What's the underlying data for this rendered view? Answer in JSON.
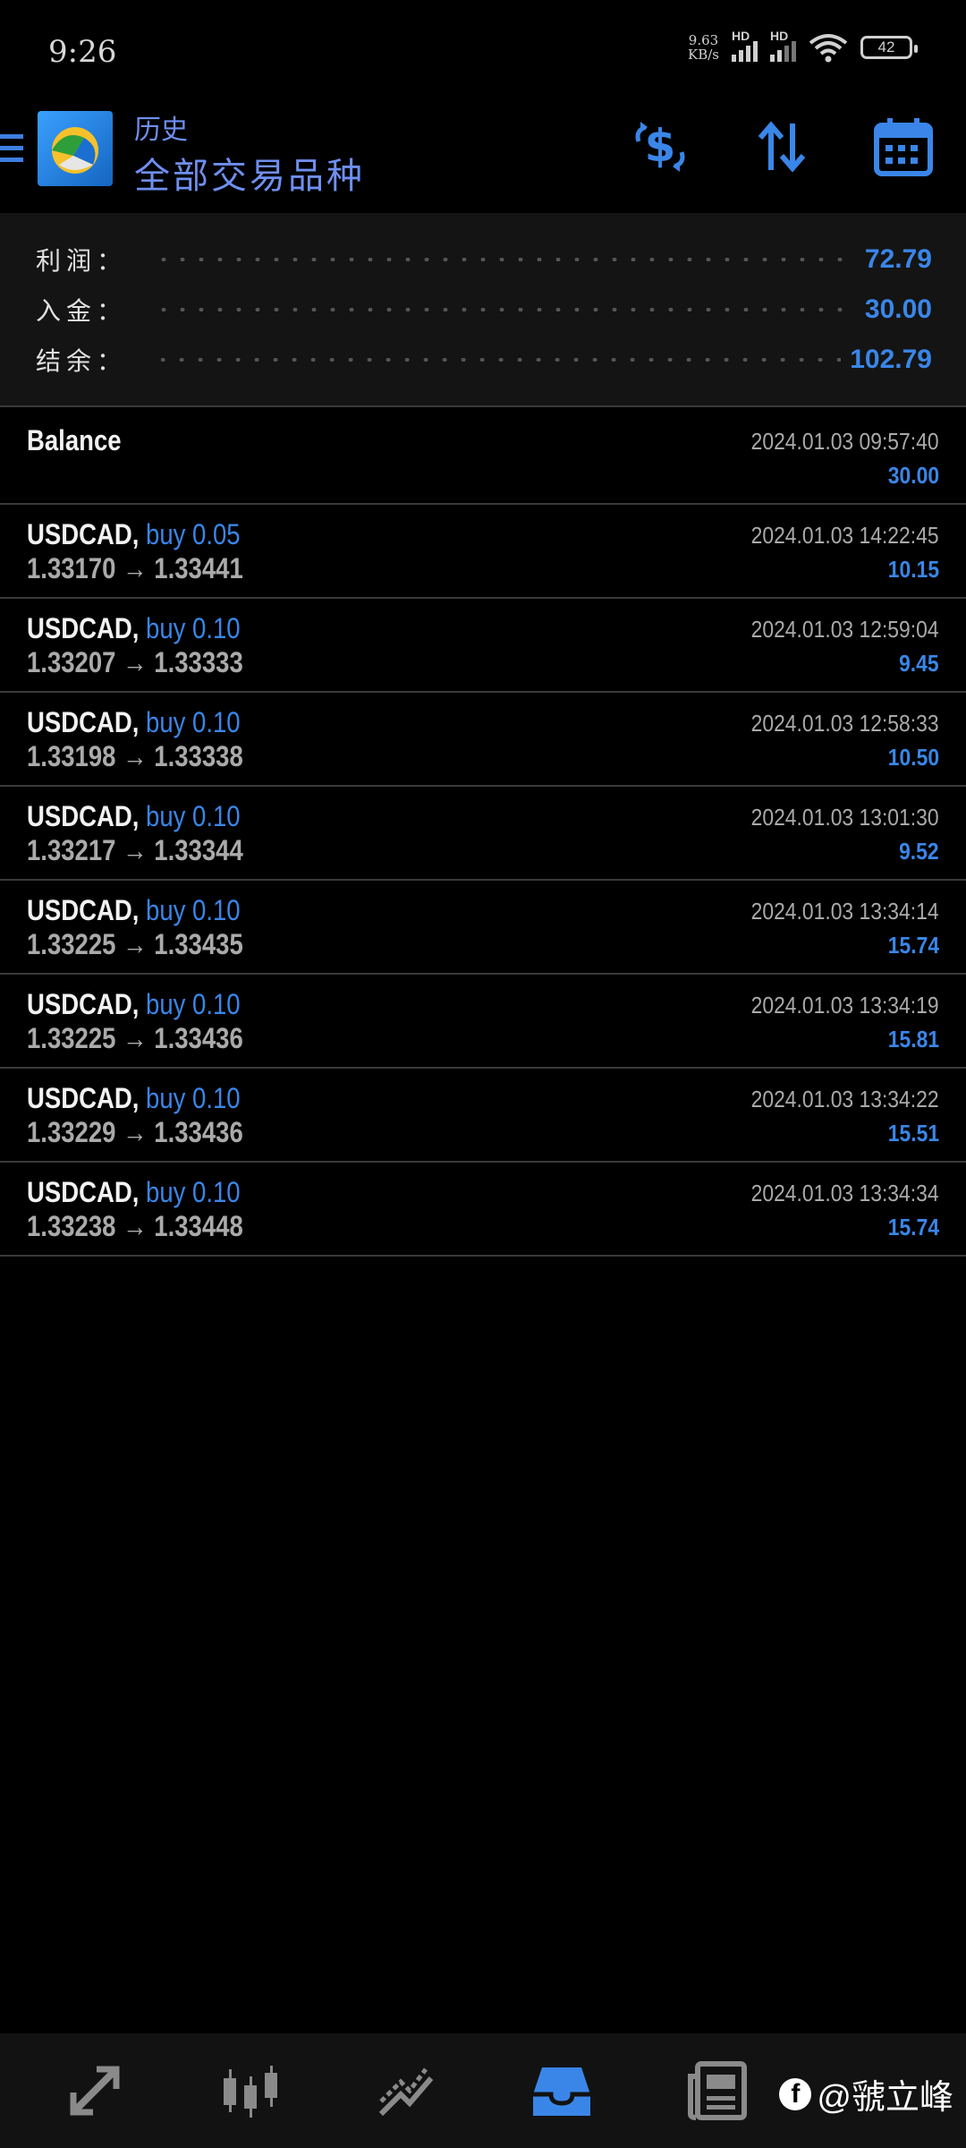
{
  "status_bar": {
    "time": "9:26",
    "net_speed_value": "9.63",
    "net_speed_unit": "KB/s",
    "hd1": "HD",
    "hd2": "HD",
    "battery": "42"
  },
  "header": {
    "subtitle": "历史",
    "title": "全部交易品种",
    "accent_color": "#3a86e8"
  },
  "summary": {
    "profit_label": "利润：",
    "profit_value": "72.79",
    "deposit_label": "入金：",
    "deposit_value": "30.00",
    "balance_label": "结余：",
    "balance_value": "102.79"
  },
  "balance_entry": {
    "label": "Balance",
    "datetime": "2024.01.03 09:57:40",
    "amount": "30.00"
  },
  "deals": [
    {
      "symbol": "USDCAD,",
      "type": "buy 0.05",
      "prices": "1.33170 → 1.33441",
      "datetime": "2024.01.03 14:22:45",
      "profit": "10.15"
    },
    {
      "symbol": "USDCAD,",
      "type": "buy 0.10",
      "prices": "1.33207 → 1.33333",
      "datetime": "2024.01.03 12:59:04",
      "profit": "9.45"
    },
    {
      "symbol": "USDCAD,",
      "type": "buy 0.10",
      "prices": "1.33198 → 1.33338",
      "datetime": "2024.01.03 12:58:33",
      "profit": "10.50"
    },
    {
      "symbol": "USDCAD,",
      "type": "buy 0.10",
      "prices": "1.33217 → 1.33344",
      "datetime": "2024.01.03 13:01:30",
      "profit": "9.52"
    },
    {
      "symbol": "USDCAD,",
      "type": "buy 0.10",
      "prices": "1.33225 → 1.33435",
      "datetime": "2024.01.03 13:34:14",
      "profit": "15.74"
    },
    {
      "symbol": "USDCAD,",
      "type": "buy 0.10",
      "prices": "1.33225 → 1.33436",
      "datetime": "2024.01.03 13:34:19",
      "profit": "15.81"
    },
    {
      "symbol": "USDCAD,",
      "type": "buy 0.10",
      "prices": "1.33229 → 1.33436",
      "datetime": "2024.01.03 13:34:22",
      "profit": "15.51"
    },
    {
      "symbol": "USDCAD,",
      "type": "buy 0.10",
      "prices": "1.33238 → 1.33448",
      "datetime": "2024.01.03 13:34:34",
      "profit": "15.74"
    }
  ],
  "bottom_nav": {
    "items": [
      "quotes-icon",
      "chart-icon",
      "trade-icon",
      "history-icon",
      "news-icon"
    ],
    "active": "history-icon"
  },
  "watermark": {
    "text": "@虢立峰"
  }
}
